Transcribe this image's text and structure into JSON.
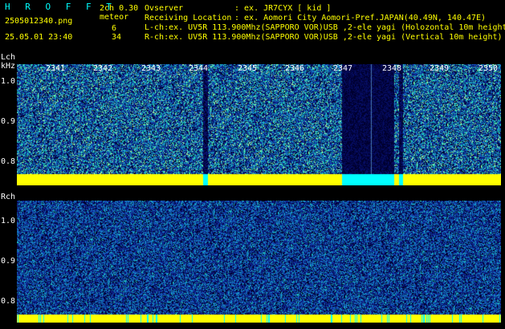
{
  "header": {
    "brand": "H R O F F T",
    "filename": "2505012340.png",
    "datetime": "25.05.01 23:40",
    "mode": "2ch 0.30",
    "meteor_label": "meteor",
    "meteor_lch": "6",
    "meteor_rch": "34",
    "observer_label": "Ovserver",
    "observer_value": ": ex. JR7CYX [ kid ]",
    "location_label": "Receiving Location",
    "location_value": ": ex. Aomori City Aomori-Pref.JAPAN(40.49N, 140.47E)",
    "lch_info": "L-ch:ex. UV5R 113.900Mhz(SAPPORO VOR)USB ,2-ele yagi (Holozontal 10m height)",
    "rch_info": "R-ch:ex. UV5R 113.900Mhz(SAPPORO VOR)USB ,2-ele yagi (Vertical 10m height)"
  },
  "lch": {
    "label": "Lch",
    "unit": "kHz",
    "time_ticks": [
      "2341",
      "2342",
      "2343",
      "2344",
      "2345",
      "2346",
      "2347",
      "2348",
      "2349",
      "2350"
    ],
    "y_ticks": [
      "1.0",
      "0.9",
      "0.8"
    ]
  },
  "rch": {
    "label": "Rch",
    "y_ticks": [
      "1.0",
      "0.9",
      "0.8"
    ]
  },
  "colors": {
    "background": "#000000",
    "header_cyan": "#00ffff",
    "header_yellow": "#ffff00",
    "noise_floor": "#ffff00"
  }
}
